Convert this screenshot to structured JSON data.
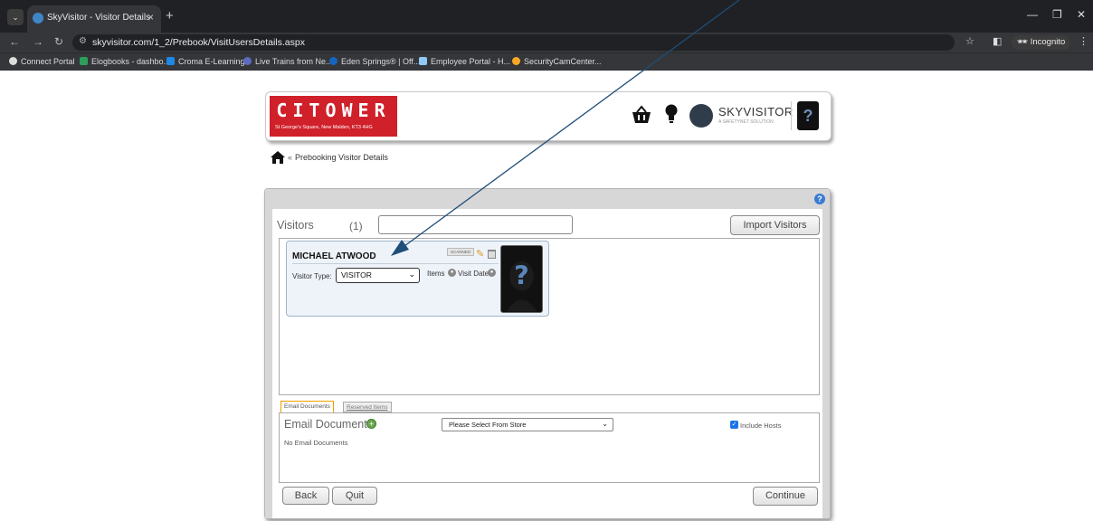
{
  "browser": {
    "tab_title": "SkyVisitor - Visitor Details",
    "tab_close": "×",
    "new_tab": "+",
    "url": "skyvisitor.com/1_2/Prebook/VisitUsersDetails.aspx",
    "incognito_label": "Incognito",
    "bookmarks": [
      {
        "label": "Connect Portal",
        "color": "#dddddd"
      },
      {
        "label": "Elogbooks - dashbo...",
        "color": "#2e9e5b"
      },
      {
        "label": "Croma E-Learning",
        "color": "#1e88e5"
      },
      {
        "label": "Live Trains from Ne...",
        "color": "#5c6bc0"
      },
      {
        "label": "Eden Springs® | Off...",
        "color": "#1565c0"
      },
      {
        "label": "Employee Portal - H...",
        "color": "#90caf9"
      },
      {
        "label": "SecurityCamCenter...",
        "color": "#f9a825"
      }
    ]
  },
  "header": {
    "logo_title": "CITOWER",
    "logo_subtitle": "St George's Square, New Malden, KT3 4HG",
    "brand_name": "SKYVISITOR",
    "brand_tagline": "A SAFETYNET SOLUTION",
    "avatar_glyph": "?"
  },
  "breadcrumb": {
    "separator": "«",
    "current": "Prebooking Visitor Details"
  },
  "visitors": {
    "label": "Visitors",
    "count": "(1)",
    "search_value": "",
    "import_button": "Import Visitors",
    "list": [
      {
        "name": "MICHAEL ATWOOD",
        "badge": "SCANNED",
        "visitor_type_label": "Visitor Type:",
        "visitor_type_value": "VISITOR",
        "items_label": "Items",
        "visit_dates_label": "Visit Dates",
        "photo_glyph": "?"
      }
    ]
  },
  "tabs": {
    "email_documents": "Email Documents",
    "reserved_items": "Reserved Items"
  },
  "email": {
    "title": "Email Documents",
    "store_select_value": "Please Select From Store",
    "include_hosts_label": "Include Hosts",
    "include_hosts_checked": true,
    "empty_text": "No Email Documents"
  },
  "footer": {
    "back_button": "Back",
    "quit_button": "Quit",
    "continue_button": "Continue"
  },
  "colors": {
    "logo_red": "#d0202a",
    "arrow": "#1f4e79",
    "active_tab_border": "#f0a000"
  }
}
